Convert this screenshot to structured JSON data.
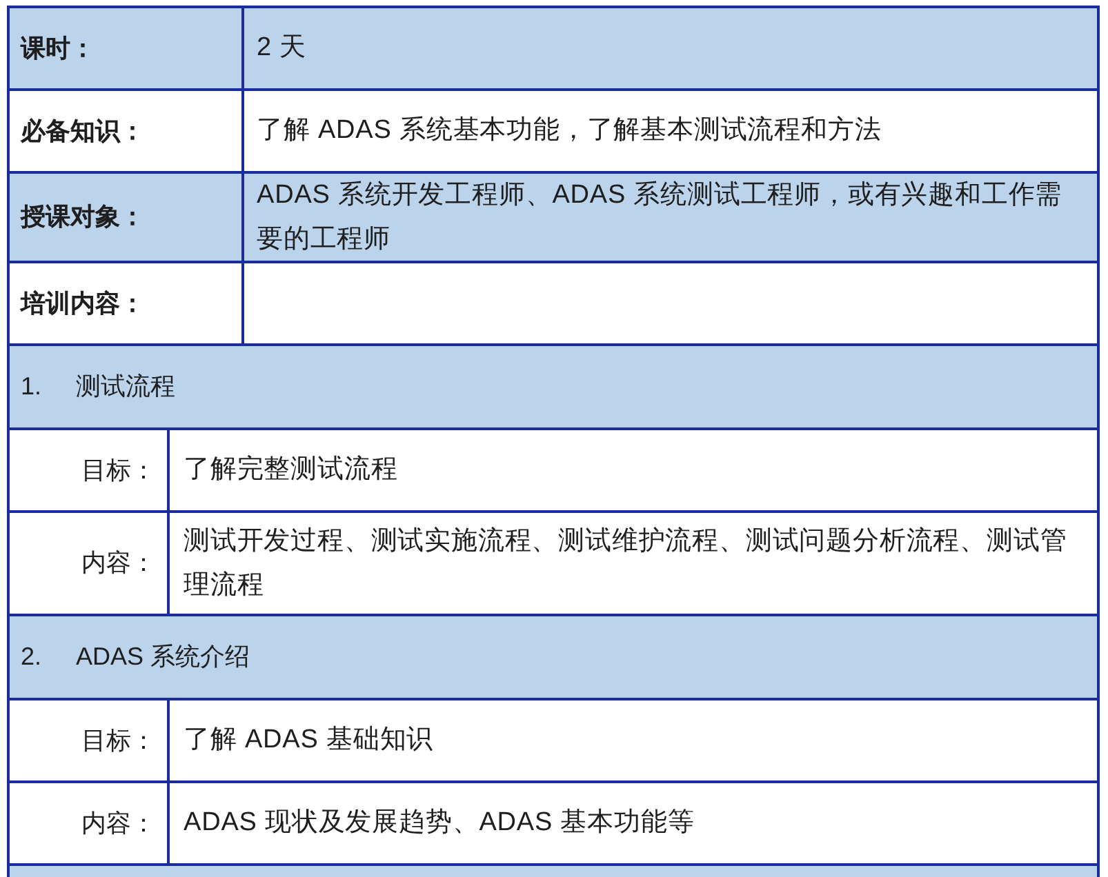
{
  "info_rows": [
    {
      "label": "课时：",
      "value": "2 天"
    },
    {
      "label": "必备知识：",
      "value": "了解 ADAS 系统基本功能，了解基本测试流程和方法"
    },
    {
      "label": "授课对象：",
      "value": "ADAS 系统开发工程师、ADAS 系统测试工程师，或有兴趣和工作需要的工程师"
    },
    {
      "label": "培训内容："
    }
  ],
  "modules": [
    {
      "number": "1.",
      "title": "测试流程",
      "details": [
        {
          "label": "目标：",
          "value": "了解完整测试流程"
        },
        {
          "label": "内容：",
          "value": "测试开发过程、测试实施流程、测试维护流程、测试问题分析流程、测试管理流程"
        }
      ]
    },
    {
      "number": "2.",
      "title": "ADAS 系统介绍",
      "details": [
        {
          "label": "目标：",
          "value": "了解 ADAS 基础知识"
        },
        {
          "label": "内容：",
          "value": "ADAS 现状及发展趋势、ADAS 基本功能等"
        }
      ]
    }
  ]
}
